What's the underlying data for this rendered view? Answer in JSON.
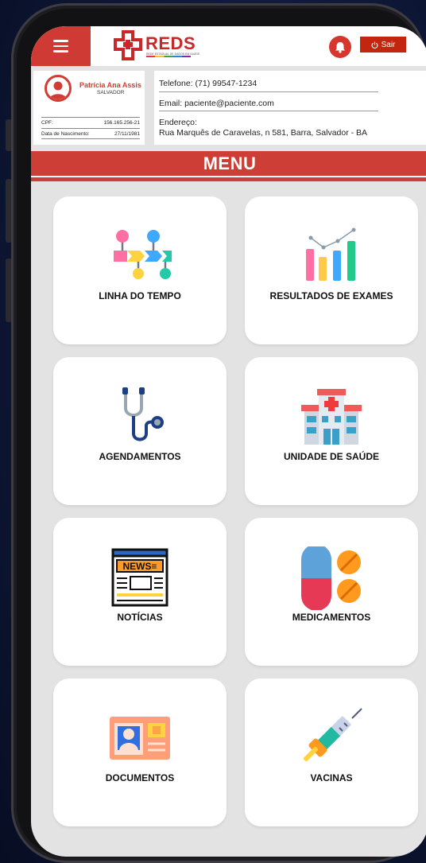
{
  "header": {
    "logo_text": "REDS",
    "logo_subtitle": "REDE ESTADUAL DE DADOS EM SAÚDE",
    "logout_label": "Sair"
  },
  "patient": {
    "name": "Patrícia Ana Assis",
    "city": "SALVADOR",
    "cpf_label": "CPF:",
    "cpf_value": "156.165.256-21",
    "dob_label": "Data de Nascimento:",
    "dob_value": "27/11/1981",
    "phone": "Telefone:   (71) 99547-1234",
    "email": "Email: paciente@paciente.com",
    "address_label": "Endereço:",
    "address_value": "Rua Marquês de Caravelas, n 581, Barra, Salvador - BA"
  },
  "menu": {
    "title": "MENU",
    "items": [
      {
        "label": "LINHA DO TEMPO",
        "icon": "timeline-icon"
      },
      {
        "label": "RESULTADOS DE EXAMES",
        "icon": "bar-chart-icon"
      },
      {
        "label": "AGENDAMENTOS",
        "icon": "stethoscope-icon"
      },
      {
        "label": "UNIDADE DE SAÚDE",
        "icon": "hospital-icon"
      },
      {
        "label": "NOTÍCIAS",
        "icon": "newspaper-icon"
      },
      {
        "label": "MEDICAMENTOS",
        "icon": "pills-icon"
      },
      {
        "label": "DOCUMENTOS",
        "icon": "id-card-icon"
      },
      {
        "label": "VACINAS",
        "icon": "syringe-icon"
      }
    ]
  },
  "colors": {
    "brand_red": "#cf3b34",
    "background": "#e3e3e3"
  }
}
